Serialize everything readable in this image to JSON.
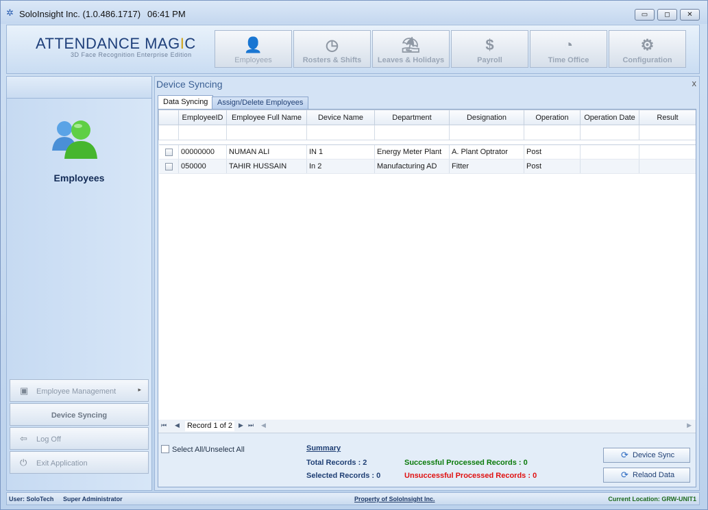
{
  "titlebar": {
    "title": "SoloInsight Inc. (1.0.486.1717)",
    "time": "06:41 PM",
    "minimize": "▭",
    "maximize": "◻",
    "close": "✕"
  },
  "header": {
    "brand": "ATTENDANCE MAG",
    "brand_dot": "I",
    "brand_end": "C",
    "subtitle": "3D Face Recognition Enterprise Edition",
    "nav": [
      {
        "label": "Employees",
        "icon": "employee-icon"
      },
      {
        "label": "Rosters & Shifts",
        "icon": "roster-clock-icon"
      },
      {
        "label": "Leaves & Holidays",
        "icon": "beach-icon"
      },
      {
        "label": "Payroll",
        "icon": "money-bag-icon"
      },
      {
        "label": "Time Office",
        "icon": "clock-icon"
      },
      {
        "label": "Configuration",
        "icon": "gears-icon"
      }
    ]
  },
  "sidebar": {
    "section_label": "Employees",
    "buttons": [
      {
        "label": "Employee Management",
        "icon": "briefcase-icon"
      },
      {
        "label": "Device Syncing"
      },
      {
        "label": "Log Off",
        "icon": "logoff-icon"
      },
      {
        "label": "Exit Application",
        "icon": "power-icon"
      }
    ]
  },
  "content": {
    "title": "Device Syncing",
    "close": "x",
    "tabs": [
      {
        "label": "Data Syncing",
        "active": true
      },
      {
        "label": "Assign/Delete Employees",
        "active": false
      }
    ],
    "columns": [
      "EmployeeID",
      "Employee Full Name",
      "Device Name",
      "Department",
      "Designation",
      "Operation",
      "Operation Date",
      "Result"
    ],
    "rows": [
      [
        "00000000",
        "NUMAN ALI",
        "IN 1",
        "Energy Meter Plant",
        "A. Plant Optrator",
        "Post",
        "",
        ""
      ],
      [
        "050000",
        "TAHIR HUSSAIN",
        "In 2",
        "Manufacturing AD",
        "Fitter",
        "Post",
        "",
        ""
      ]
    ],
    "pager": {
      "record": "Record 1 of 2"
    },
    "select_all": "Select All/Unselect All",
    "summary": {
      "heading": "Summary",
      "total": "Total Records : 2",
      "selected": "Selected Records : 0",
      "successful": "Successful Processed Records : 0",
      "unsuccessful": "Unsuccessful Processed Records : 0"
    },
    "actions": {
      "sync": "Device Sync",
      "reload": "Relaod Data"
    },
    "colors": {
      "success": "#0a7a0a",
      "fail": "#e01010",
      "label": "#1f3f74"
    }
  },
  "statusbar": {
    "user": "User: SoloTech",
    "role": "Super Administrator",
    "property": "Property of SoloInsight Inc.",
    "location": "Current Location: GRW-UNIT1"
  }
}
